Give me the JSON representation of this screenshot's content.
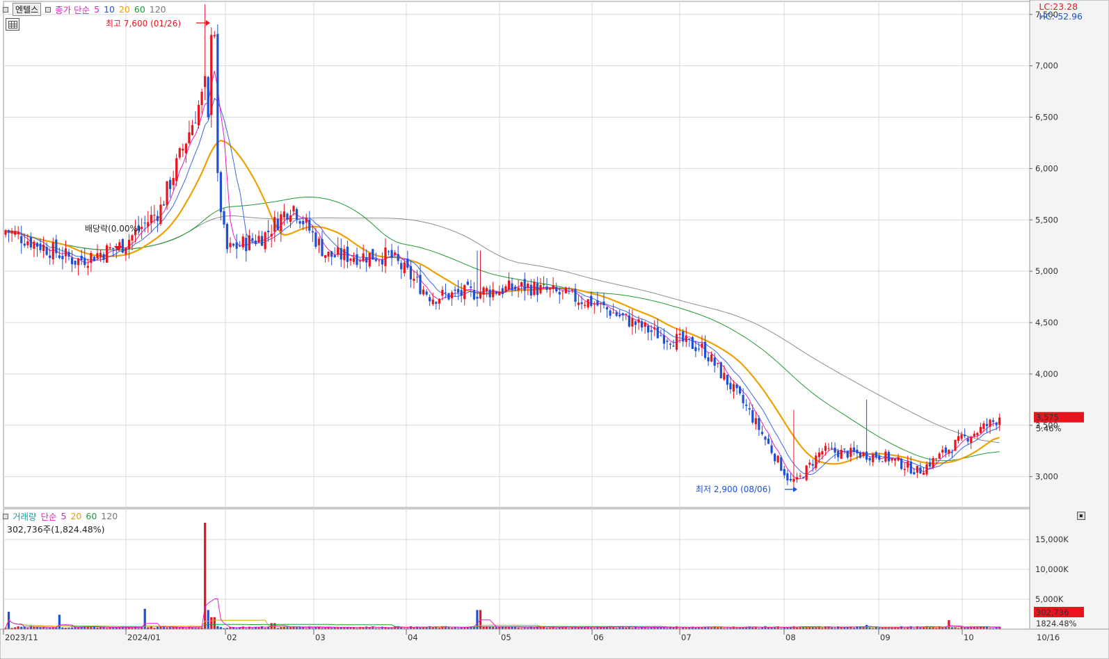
{
  "price_legend": {
    "stock_name": "엔텔스",
    "ma_label": "종가 단순",
    "ma_periods": [
      "5",
      "10",
      "20",
      "60",
      "120"
    ]
  },
  "indicators": {
    "lc": "LC:23.28",
    "hc": "HC:-52.96"
  },
  "annotations": {
    "high": "최고 7,600 (01/26)",
    "low": "최저 2,900 (08/06)",
    "dividend": "배당락(0.00%)"
  },
  "price_axis": {
    "ticks": [
      3000,
      3500,
      4000,
      4500,
      5000,
      5500,
      6000,
      6500,
      7000,
      7500
    ],
    "tick_labels": [
      "3,000",
      "3,500",
      "4,000",
      "4,500",
      "5,000",
      "5,500",
      "6,000",
      "6,500",
      "7,000",
      "7,500"
    ],
    "current_price": "3,575",
    "current_change": "5.46%"
  },
  "volume_legend": {
    "label": "거래량",
    "ma_label": "단순",
    "ma_periods": [
      "5",
      "20",
      "60",
      "120"
    ],
    "current_text": "302,736주(1,824.48%)"
  },
  "volume_axis": {
    "ticks": [
      5000,
      10000,
      15000
    ],
    "tick_labels": [
      "5,000K",
      "10,000K",
      "15,000K"
    ],
    "current_volume": "302,736",
    "current_pct": "1824.48%"
  },
  "date_axis": {
    "labels": [
      "2023/11",
      "2024/01",
      "02",
      "03",
      "04",
      "05",
      "06",
      "07",
      "08",
      "09",
      "10"
    ],
    "right_label": "10/16"
  },
  "colors": {
    "up": "#e8141e",
    "down": "#1e50d2",
    "ma5": "#e61ec8",
    "ma10": "#3c64e6",
    "ma20": "#f0a000",
    "ma60": "#1e9b32",
    "ma120": "#8c8c8c",
    "grid": "#d8d8d8",
    "price_box": "#e8141e"
  },
  "chart_data": {
    "type": "candlestick",
    "title": "엔텔스",
    "price_range": [
      2700,
      7600
    ],
    "months": [
      "2023/11",
      "2024/01",
      "02",
      "03",
      "04",
      "05",
      "06",
      "07",
      "08",
      "09",
      "10"
    ],
    "close_anchors": [
      [
        "2023/11",
        5400
      ],
      [
        "2023/12",
        5100
      ],
      [
        "2024/01 early",
        5250
      ],
      [
        "2024/01 mid",
        5600
      ],
      [
        "2024/01/26",
        6800
      ],
      [
        "02 early",
        5200
      ],
      [
        "02 mid",
        5350
      ],
      [
        "02 late",
        5650
      ],
      [
        "03",
        5150
      ],
      [
        "04 early",
        5150
      ],
      [
        "04 mid",
        4750
      ],
      [
        "05",
        4850
      ],
      [
        "06",
        4700
      ],
      [
        "07 early",
        4400
      ],
      [
        "07 mid",
        4250
      ],
      [
        "07 late",
        3650
      ],
      [
        "08/06",
        2900
      ],
      [
        "08 mid",
        3250
      ],
      [
        "09",
        3200
      ],
      [
        "09 late",
        3050
      ],
      [
        "10 early",
        3350
      ],
      [
        "10/16",
        3575
      ]
    ],
    "high": 7600,
    "high_date": "01/26",
    "low": 2900,
    "low_date": "08/06",
    "last_close": 3575,
    "last_change_pct": 5.46,
    "volume_peak_k": 17800,
    "last_volume": 302736
  }
}
